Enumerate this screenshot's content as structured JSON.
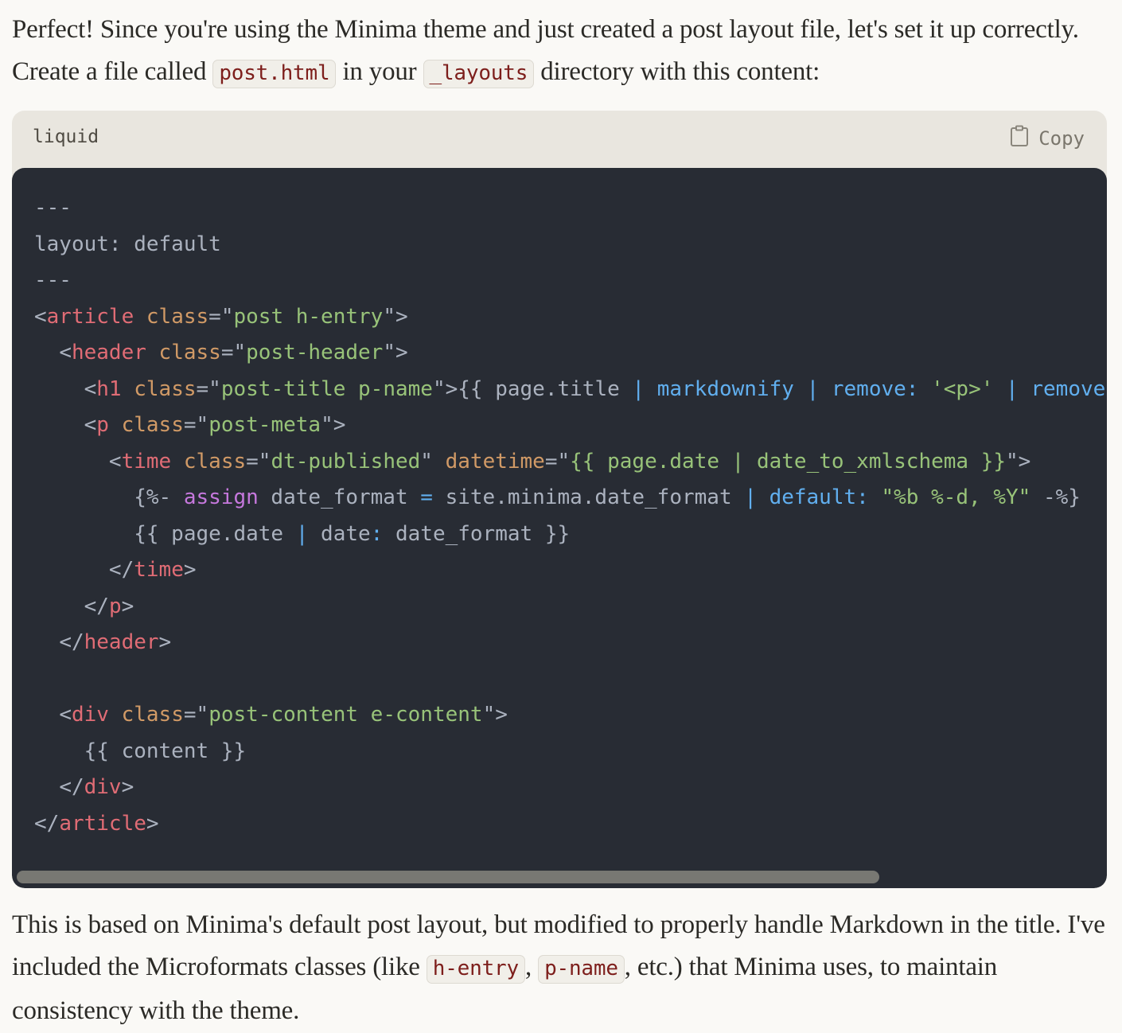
{
  "intro": {
    "part1": "Perfect! Since you're using the Minima theme and just created a post layout file, let's set it up correctly. Create a file called ",
    "code1": "post.html",
    "part2": " in your ",
    "code2": "_layouts",
    "part3": " directory with this content:"
  },
  "code_block": {
    "language": "liquid",
    "copy_label": "Copy",
    "copy_icon": "clipboard-icon",
    "lines": [
      [
        {
          "t": "plain",
          "v": "---"
        }
      ],
      [
        {
          "t": "plain",
          "v": "layout: default"
        }
      ],
      [
        {
          "t": "plain",
          "v": "---"
        }
      ],
      [
        {
          "t": "punct",
          "v": "<"
        },
        {
          "t": "tag",
          "v": "article"
        },
        {
          "t": "plain",
          "v": " "
        },
        {
          "t": "attr",
          "v": "class"
        },
        {
          "t": "punct",
          "v": "=\""
        },
        {
          "t": "str",
          "v": "post h-entry"
        },
        {
          "t": "punct",
          "v": "\">"
        }
      ],
      [
        {
          "t": "plain",
          "v": "  "
        },
        {
          "t": "punct",
          "v": "<"
        },
        {
          "t": "tag",
          "v": "header"
        },
        {
          "t": "plain",
          "v": " "
        },
        {
          "t": "attr",
          "v": "class"
        },
        {
          "t": "punct",
          "v": "=\""
        },
        {
          "t": "str",
          "v": "post-header"
        },
        {
          "t": "punct",
          "v": "\">"
        }
      ],
      [
        {
          "t": "plain",
          "v": "    "
        },
        {
          "t": "punct",
          "v": "<"
        },
        {
          "t": "tag",
          "v": "h1"
        },
        {
          "t": "plain",
          "v": " "
        },
        {
          "t": "attr",
          "v": "class"
        },
        {
          "t": "punct",
          "v": "=\""
        },
        {
          "t": "str",
          "v": "post-title p-name"
        },
        {
          "t": "punct",
          "v": "\">"
        },
        {
          "t": "plain",
          "v": "{{ page.title "
        },
        {
          "t": "pipe",
          "v": "| markdownify | remove:"
        },
        {
          "t": "plain",
          "v": " "
        },
        {
          "t": "str",
          "v": "'<p>'"
        },
        {
          "t": "plain",
          "v": " "
        },
        {
          "t": "pipe",
          "v": "| remove: '</p>' }}"
        }
      ],
      [
        {
          "t": "plain",
          "v": "    "
        },
        {
          "t": "punct",
          "v": "<"
        },
        {
          "t": "tag",
          "v": "p"
        },
        {
          "t": "plain",
          "v": " "
        },
        {
          "t": "attr",
          "v": "class"
        },
        {
          "t": "punct",
          "v": "=\""
        },
        {
          "t": "str",
          "v": "post-meta"
        },
        {
          "t": "punct",
          "v": "\">"
        }
      ],
      [
        {
          "t": "plain",
          "v": "      "
        },
        {
          "t": "punct",
          "v": "<"
        },
        {
          "t": "tag",
          "v": "time"
        },
        {
          "t": "plain",
          "v": " "
        },
        {
          "t": "attr",
          "v": "class"
        },
        {
          "t": "punct",
          "v": "=\""
        },
        {
          "t": "str",
          "v": "dt-published"
        },
        {
          "t": "punct",
          "v": "\""
        },
        {
          "t": "plain",
          "v": " "
        },
        {
          "t": "attr",
          "v": "datetime"
        },
        {
          "t": "punct",
          "v": "=\""
        },
        {
          "t": "str",
          "v": "{{ page.date | date_to_xmlschema }}"
        },
        {
          "t": "punct",
          "v": "\">"
        }
      ],
      [
        {
          "t": "plain",
          "v": "        {%- "
        },
        {
          "t": "kw",
          "v": "assign"
        },
        {
          "t": "plain",
          "v": " date_format "
        },
        {
          "t": "pipe",
          "v": "="
        },
        {
          "t": "plain",
          "v": " site.minima.date_format "
        },
        {
          "t": "pipe",
          "v": "| default:"
        },
        {
          "t": "plain",
          "v": " "
        },
        {
          "t": "str",
          "v": "\"%b %-d, %Y\""
        },
        {
          "t": "plain",
          "v": " -%}"
        }
      ],
      [
        {
          "t": "plain",
          "v": "        {{ page.date "
        },
        {
          "t": "pipe",
          "v": "|"
        },
        {
          "t": "plain",
          "v": " date"
        },
        {
          "t": "pipe",
          "v": ":"
        },
        {
          "t": "plain",
          "v": " date_format }}"
        }
      ],
      [
        {
          "t": "plain",
          "v": "      "
        },
        {
          "t": "punct",
          "v": "</"
        },
        {
          "t": "tag",
          "v": "time"
        },
        {
          "t": "punct",
          "v": ">"
        }
      ],
      [
        {
          "t": "plain",
          "v": "    "
        },
        {
          "t": "punct",
          "v": "</"
        },
        {
          "t": "tag",
          "v": "p"
        },
        {
          "t": "punct",
          "v": ">"
        }
      ],
      [
        {
          "t": "plain",
          "v": "  "
        },
        {
          "t": "punct",
          "v": "</"
        },
        {
          "t": "tag",
          "v": "header"
        },
        {
          "t": "punct",
          "v": ">"
        }
      ],
      [],
      [
        {
          "t": "plain",
          "v": "  "
        },
        {
          "t": "punct",
          "v": "<"
        },
        {
          "t": "tag",
          "v": "div"
        },
        {
          "t": "plain",
          "v": " "
        },
        {
          "t": "attr",
          "v": "class"
        },
        {
          "t": "punct",
          "v": "=\""
        },
        {
          "t": "str",
          "v": "post-content e-content"
        },
        {
          "t": "punct",
          "v": "\">"
        }
      ],
      [
        {
          "t": "plain",
          "v": "    {{ content }}"
        }
      ],
      [
        {
          "t": "plain",
          "v": "  "
        },
        {
          "t": "punct",
          "v": "</"
        },
        {
          "t": "tag",
          "v": "div"
        },
        {
          "t": "punct",
          "v": ">"
        }
      ],
      [
        {
          "t": "punct",
          "v": "</"
        },
        {
          "t": "tag",
          "v": "article"
        },
        {
          "t": "punct",
          "v": ">"
        }
      ]
    ]
  },
  "outro": {
    "part1": "This is based on Minima's default post layout, but modified to properly handle Markdown in the title. I've included the Microformats classes (like ",
    "code1": "h-entry",
    "part2": ", ",
    "code2": "p-name",
    "part3": ", etc.) that Minima uses, to maintain consistency with the theme."
  }
}
